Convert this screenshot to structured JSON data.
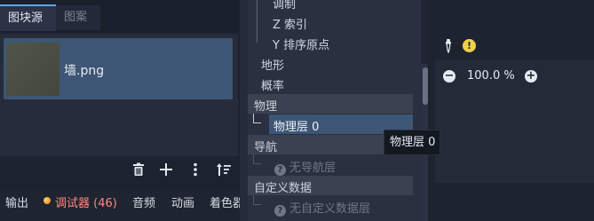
{
  "left_panel": {
    "tabs": [
      {
        "label": "图块源",
        "active": true
      },
      {
        "label": "图案",
        "active": false
      }
    ],
    "items": [
      {
        "name": "墙.png"
      }
    ],
    "toolbar_icons": [
      "trash-icon",
      "plus-icon",
      "kebab-menu-icon",
      "sort-icon"
    ]
  },
  "bottom_bar": {
    "tabs": [
      {
        "label": "输出"
      },
      {
        "label": "调试器 (46)"
      },
      {
        "label": "音频"
      },
      {
        "label": "动画"
      },
      {
        "label": "着色器"
      }
    ]
  },
  "inspector": {
    "rows": {
      "modulate": "调制",
      "z_index": "Z 索引",
      "y_sort_origin": "Y 排序原点",
      "terrain": "地形",
      "probability": "概率"
    },
    "sections": {
      "physics": "物理",
      "navigation": "导航",
      "custom_data": "自定义数据"
    },
    "physics_layer": "物理层 0",
    "no_navigation_layer": "无导航层",
    "no_custom_data_layer": "无自定义数据层"
  },
  "tooltip": {
    "text": "物理层 0"
  },
  "right_panel": {
    "zoom": "100.0 %"
  },
  "colors": {
    "accent": "#5ea6e8",
    "selection": "#3d5675",
    "debugger_text": "#ff8a7a",
    "warning": "#f0d04a"
  }
}
